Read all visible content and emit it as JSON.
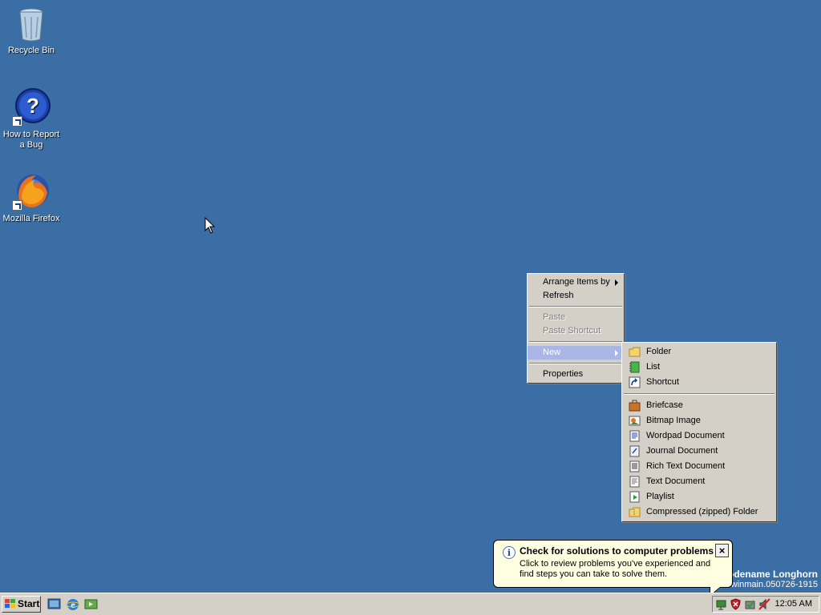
{
  "desktop_icons": [
    {
      "label": "Recycle Bin",
      "icon": "recycle-bin-icon"
    },
    {
      "label": "How to Report a Bug",
      "icon": "help-icon"
    },
    {
      "label": "Mozilla Firefox",
      "icon": "firefox-icon"
    }
  ],
  "context_menu": {
    "arrange": "Arrange Items by",
    "refresh": "Refresh",
    "paste": "Paste",
    "paste_shortcut": "Paste Shortcut",
    "new": "New",
    "properties": "Properties"
  },
  "new_submenu": {
    "folder": "Folder",
    "list": "List",
    "shortcut": "Shortcut",
    "briefcase": "Briefcase",
    "bitmap": "Bitmap Image",
    "wordpad": "Wordpad Document",
    "journal": "Journal Document",
    "richtext": "Rich Text Document",
    "text": "Text Document",
    "playlist": "Playlist",
    "zip": "Compressed (zipped) Folder"
  },
  "balloon": {
    "title": "Check for solutions to computer problems",
    "text": "Click to review problems you've experienced and find steps you can take to solve them."
  },
  "watermark": {
    "line1": "odename Longhorn",
    "line2": "winmain.050726-1915"
  },
  "taskbar": {
    "start_label": "Start",
    "clock": "12:05 AM"
  },
  "colors": {
    "desktop": "#3a6ea5",
    "menu_face": "#d4d0c8",
    "highlight": "#aab6e6",
    "balloon": "#ffffe1"
  }
}
